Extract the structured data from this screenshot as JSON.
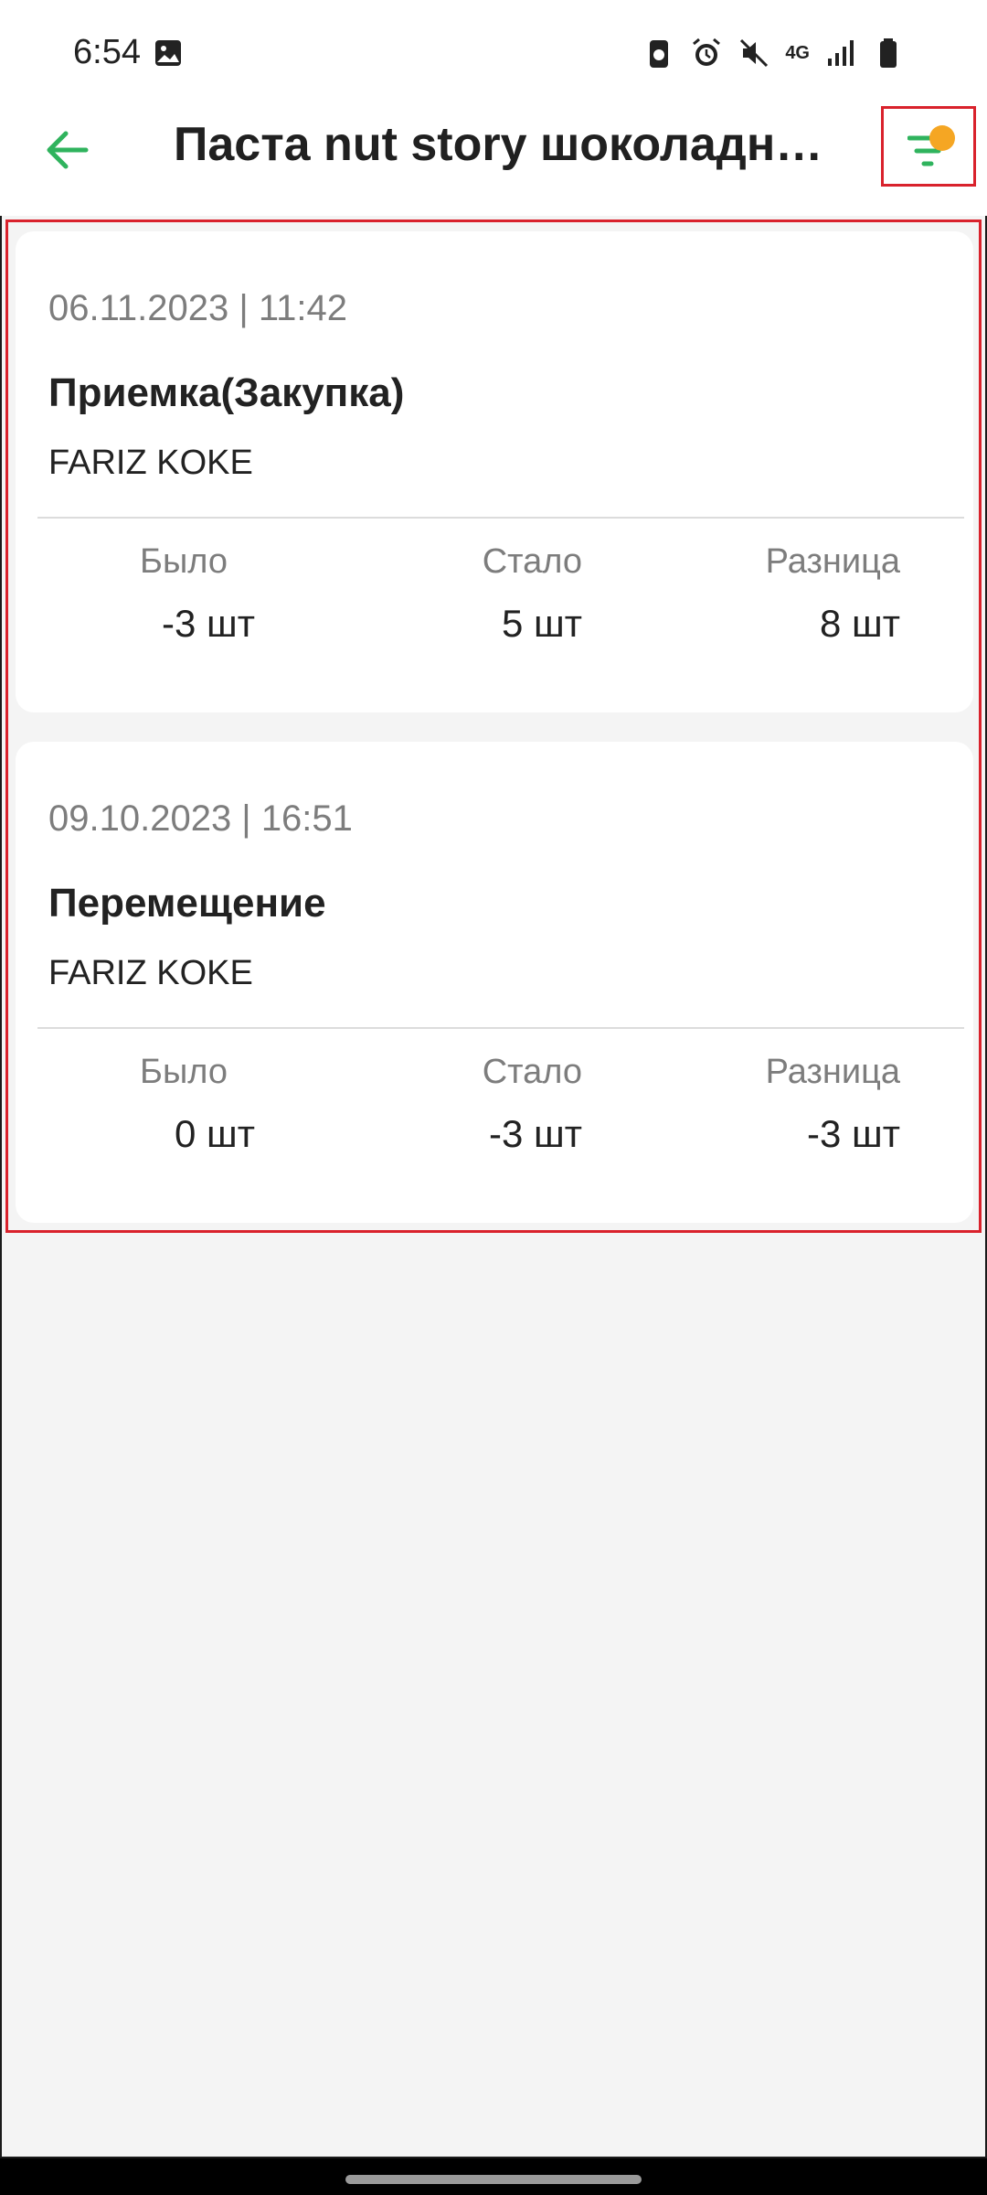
{
  "status_bar": {
    "time": "6:54",
    "network": "4G"
  },
  "app_bar": {
    "title": "Паста nut story шоколадно-..."
  },
  "colors": {
    "accent_green": "#2fb35d",
    "filter_dot": "#f5a623",
    "highlight_red": "#d9222c"
  },
  "records": [
    {
      "datetime": "06.11.2023 | 11:42",
      "type": "Приемка(Закупка)",
      "user": "FARIZ KOKE",
      "was_label": "Было",
      "became_label": "Стало",
      "diff_label": "Разница",
      "was": "-3 шт",
      "became": "5 шт",
      "diff": "8 шт"
    },
    {
      "datetime": "09.10.2023 | 16:51",
      "type": "Перемещение",
      "user": "FARIZ KOKE",
      "was_label": "Было",
      "became_label": "Стало",
      "diff_label": "Разница",
      "was": "0 шт",
      "became": "-3 шт",
      "diff": "-3 шт"
    }
  ]
}
